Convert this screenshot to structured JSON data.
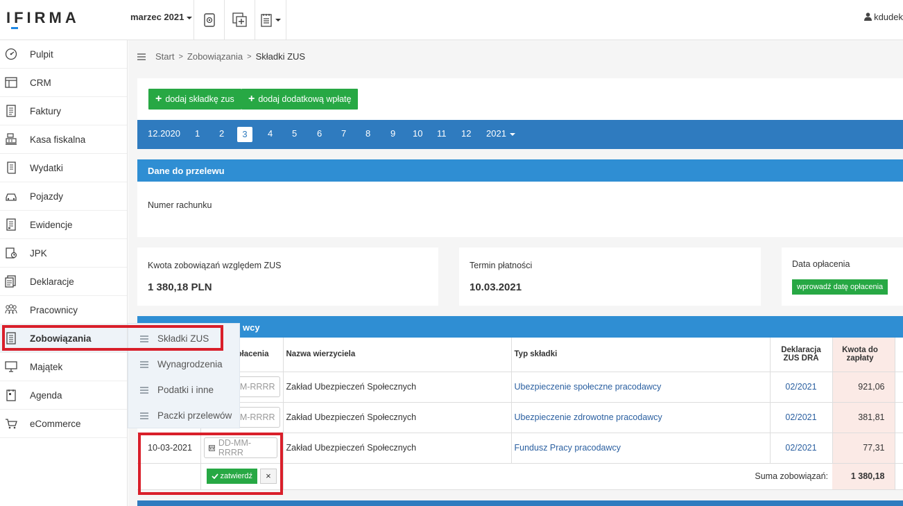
{
  "header": {
    "logo": "IFIRMA",
    "month_selector": "marzec 2021",
    "user": "kdudek"
  },
  "sidebar": {
    "items": [
      {
        "label": "Pulpit",
        "icon": "dashboard-icon"
      },
      {
        "label": "CRM",
        "icon": "crm-icon"
      },
      {
        "label": "Faktury",
        "icon": "invoice-icon"
      },
      {
        "label": "Kasa fiskalna",
        "icon": "cash-register-icon"
      },
      {
        "label": "Wydatki",
        "icon": "expenses-icon"
      },
      {
        "label": "Pojazdy",
        "icon": "car-icon"
      },
      {
        "label": "Ewidencje",
        "icon": "records-icon"
      },
      {
        "label": "JPK",
        "icon": "jpk-icon"
      },
      {
        "label": "Deklaracje",
        "icon": "declarations-icon"
      },
      {
        "label": "Pracownicy",
        "icon": "employees-icon"
      },
      {
        "label": "Zobowiązania",
        "icon": "liabilities-icon"
      },
      {
        "label": "Majątek",
        "icon": "assets-icon"
      },
      {
        "label": "Agenda",
        "icon": "agenda-icon"
      },
      {
        "label": "eCommerce",
        "icon": "cart-icon"
      }
    ]
  },
  "submenu": {
    "items": [
      "Składki ZUS",
      "Wynagrodzenia",
      "Podatki i inne",
      "Paczki przelewów"
    ]
  },
  "breadcrumb": {
    "items": [
      "Start",
      "Zobowiązania",
      "Składki ZUS"
    ]
  },
  "actions": {
    "add_zus": "dodaj składkę zus",
    "add_extra": "dodaj dodatkową wpłatę"
  },
  "months": {
    "prev": "12.2020",
    "list": [
      "1",
      "2",
      "3",
      "4",
      "5",
      "6",
      "7",
      "8",
      "9",
      "10",
      "11",
      "12"
    ],
    "selected": "3",
    "year": "2021"
  },
  "transfer": {
    "title": "Dane do przelewu",
    "account_label": "Numer rachunku"
  },
  "summary": {
    "amount_label": "Kwota zobowiązań względem ZUS",
    "amount_value": "1 380,18 PLN",
    "due_label": "Termin płatności",
    "due_value": "10.03.2021",
    "paid_label": "Data opłacenia",
    "paid_button": "wprowadź datę opłacenia"
  },
  "table": {
    "title_visible": "wcy",
    "headers": {
      "pay_date_partial": "płacenia",
      "creditor": "Nazwa wierzyciela",
      "type": "Typ składki",
      "declaration": "Deklaracja ZUS DRA",
      "amount": "Kwota do zapłaty"
    },
    "rows": [
      {
        "date_placeholder_partial": "M-RRRR",
        "creditor": "Zakład Ubezpieczeń Społecznych",
        "type": "Ubezpieczenie społeczne pracodawcy",
        "declaration": "02/2021",
        "amount": "921,06"
      },
      {
        "date_placeholder_partial": "M-RRRR",
        "creditor": "Zakład Ubezpieczeń Społecznych",
        "type": "Ubezpieczenie zdrowotne pracodawcy",
        "declaration": "02/2021",
        "amount": "381,81"
      },
      {
        "first_col": "10-03-2021",
        "date_placeholder": "DD-MM-RRRR",
        "creditor": "Zakład Ubezpieczeń Społecznych",
        "type": "Fundusz Pracy pracodawcy",
        "declaration": "02/2021",
        "amount": "77,31"
      }
    ],
    "confirm_button": "zatwierdź",
    "cancel_button": "×",
    "sum_label": "Suma zobowiązań:",
    "sum_value": "1 380,18"
  },
  "colors": {
    "primary_blue": "#2f7bbf",
    "header_blue": "#2f8ed3",
    "green": "#27a844",
    "highlight_red": "#d91f2a",
    "amount_bg": "#fbeae6"
  }
}
